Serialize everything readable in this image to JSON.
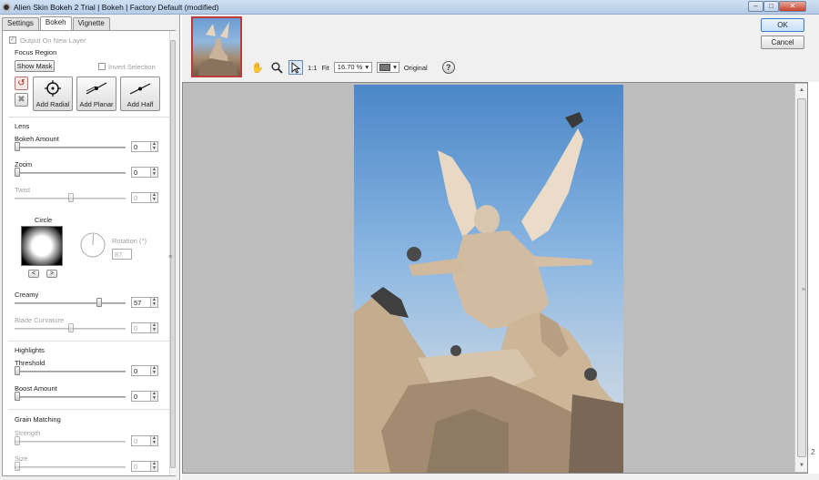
{
  "window": {
    "title": "Alien Skin Bokeh 2 Trial | Bokeh | Factory Default (modified)",
    "min_glyph": "–",
    "max_glyph": "□",
    "close_glyph": "✕"
  },
  "tabs": [
    {
      "label": "Settings",
      "active": false
    },
    {
      "label": "Bokeh",
      "active": true
    },
    {
      "label": "Vignette",
      "active": false
    }
  ],
  "panel": {
    "output_on_new_layer": "Output On New Layer",
    "focus_region": {
      "heading": "Focus Region",
      "show_mask": "Show Mask",
      "invert_selection": "Invert Selection",
      "add_radial": "Add Radial",
      "add_planar": "Add Planar",
      "add_half": "Add Half"
    },
    "lens": {
      "heading": "Lens",
      "bokeh_amount": {
        "label": "Bokeh Amount",
        "value": "0"
      },
      "zoom": {
        "label": "Zoom",
        "value": "0"
      },
      "twist": {
        "label": "Twist",
        "value": "0"
      },
      "circle": "Circle",
      "rotation_label": "Rotation (°)",
      "rotation_value": "87",
      "prev_glyph": "<",
      "next_glyph": ">",
      "creamy": {
        "label": "Creamy",
        "value": "57"
      },
      "blade_curvature": {
        "label": "Blade Curvature",
        "value": "0"
      }
    },
    "highlights": {
      "heading": "Highlights",
      "threshold": {
        "label": "Threshold",
        "value": "0"
      },
      "boost_amount": {
        "label": "Boost Amount",
        "value": "0"
      }
    },
    "grain": {
      "heading": "Grain Matching",
      "strength": {
        "label": "Strength",
        "value": "0"
      },
      "size": {
        "label": "Size",
        "value": "0"
      }
    }
  },
  "toolbar": {
    "zoom_1_1": "1:1",
    "fit": "Fit",
    "zoom_value": "16.70 %",
    "original": "Original",
    "help_glyph": "?",
    "dropdown_glyph": "▾"
  },
  "buttons": {
    "ok": "OK",
    "cancel": "Cancel"
  },
  "splitter_glyph": "≡",
  "scroll_grip_glyph": "≡",
  "corner_digit": "2",
  "accent_colors": {
    "title_bar": "#b6cde8",
    "thumbnail_border": "#c03a3a",
    "ok_border": "#3d7bc7"
  }
}
